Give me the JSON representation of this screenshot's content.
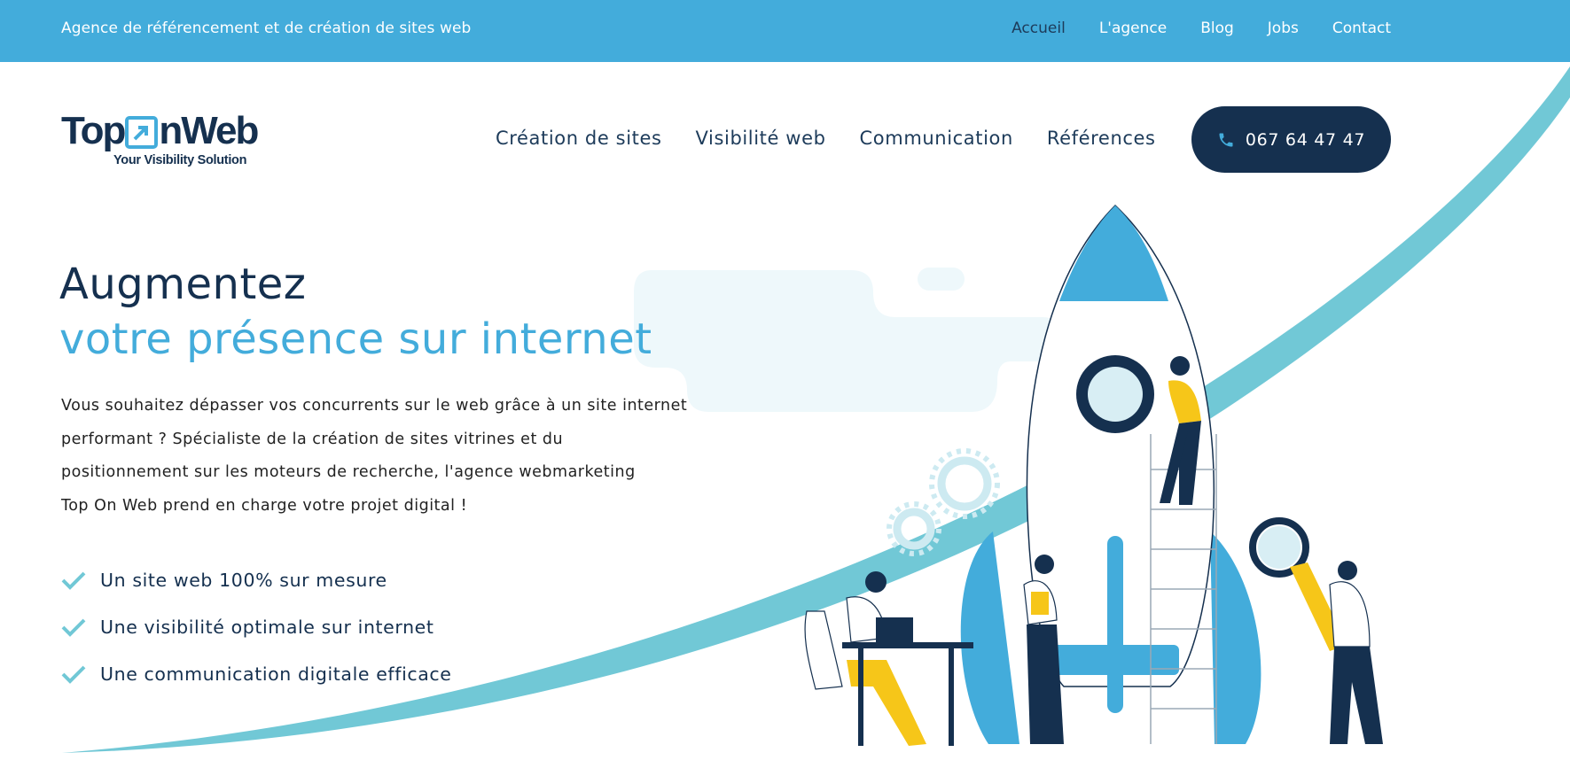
{
  "topbar": {
    "tagline": "Agence de référencement et de création de sites web",
    "links": [
      "Accueil",
      "L'agence",
      "Blog",
      "Jobs",
      "Contact"
    ],
    "active": "Accueil"
  },
  "logo": {
    "text_before": "Top",
    "text_after": "nWeb",
    "slogan": "Your Visibility Solution"
  },
  "nav": {
    "items": [
      "Création de sites",
      "Visibilité web",
      "Communication",
      "Références"
    ]
  },
  "phone": {
    "number": "067 64 47 47",
    "icon": "phone-icon"
  },
  "hero": {
    "title_line1": "Augmentez",
    "title_line2": "votre présence sur internet",
    "intro_lines": [
      "Vous souhaitez dépasser vos concurrents sur le web grâce à un site internet",
      "performant ? Spécialiste de la création de sites vitrines et du",
      "positionnement sur les moteurs de recherche, l'agence webmarketing",
      "Top On Web prend en charge votre projet digital !"
    ],
    "features": [
      "Un site web 100% sur mesure",
      "Une visibilité optimale sur internet",
      "Une communication digitale efficace"
    ]
  },
  "colors": {
    "brand_blue": "#43acdb",
    "navy": "#15304f",
    "teal": "#71c8d6",
    "yellow": "#f6c619",
    "cloud": "#eef8fb"
  }
}
